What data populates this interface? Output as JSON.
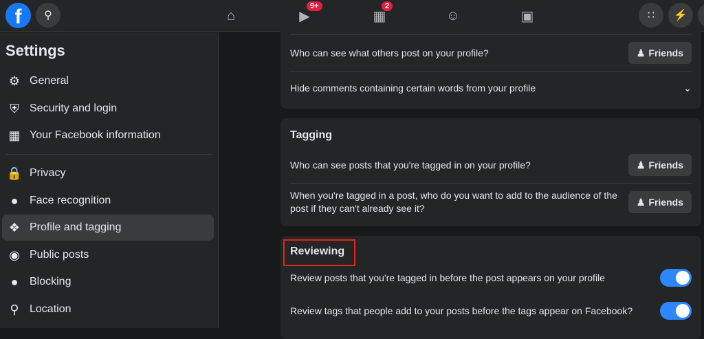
{
  "header": {
    "logo": "f",
    "video_badge": "9+",
    "marketplace_badge": "2"
  },
  "sidebar": {
    "title": "Settings",
    "items": [
      {
        "label": "General",
        "icon": "gear-icon"
      },
      {
        "label": "Security and login",
        "icon": "shield-icon"
      },
      {
        "label": "Your Facebook information",
        "icon": "grid-icon"
      },
      {
        "label": "Privacy",
        "icon": "lock-icon"
      },
      {
        "label": "Face recognition",
        "icon": "person-icon"
      },
      {
        "label": "Profile and tagging",
        "icon": "tag-icon"
      },
      {
        "label": "Public posts",
        "icon": "globe-icon"
      },
      {
        "label": "Blocking",
        "icon": "block-user-icon"
      },
      {
        "label": "Location",
        "icon": "pin-icon"
      }
    ]
  },
  "main": {
    "top_card": {
      "q1": "Who can see what others post on your profile?",
      "q1_value": "Friends",
      "q2": "Hide comments containing certain words from your profile"
    },
    "tagging": {
      "title": "Tagging",
      "q1": "Who can see posts that you're tagged in on your profile?",
      "q1_value": "Friends",
      "q2": "When you're tagged in a post, who do you want to add to the audience of the post if they can't already see it?",
      "q2_value": "Friends"
    },
    "reviewing": {
      "title": "Reviewing",
      "q1": "Review posts that you're tagged in before the post appears on your profile",
      "q1_on": true,
      "q2": "Review tags that people add to your posts before the tags appear on Facebook?",
      "q2_on": true
    }
  }
}
